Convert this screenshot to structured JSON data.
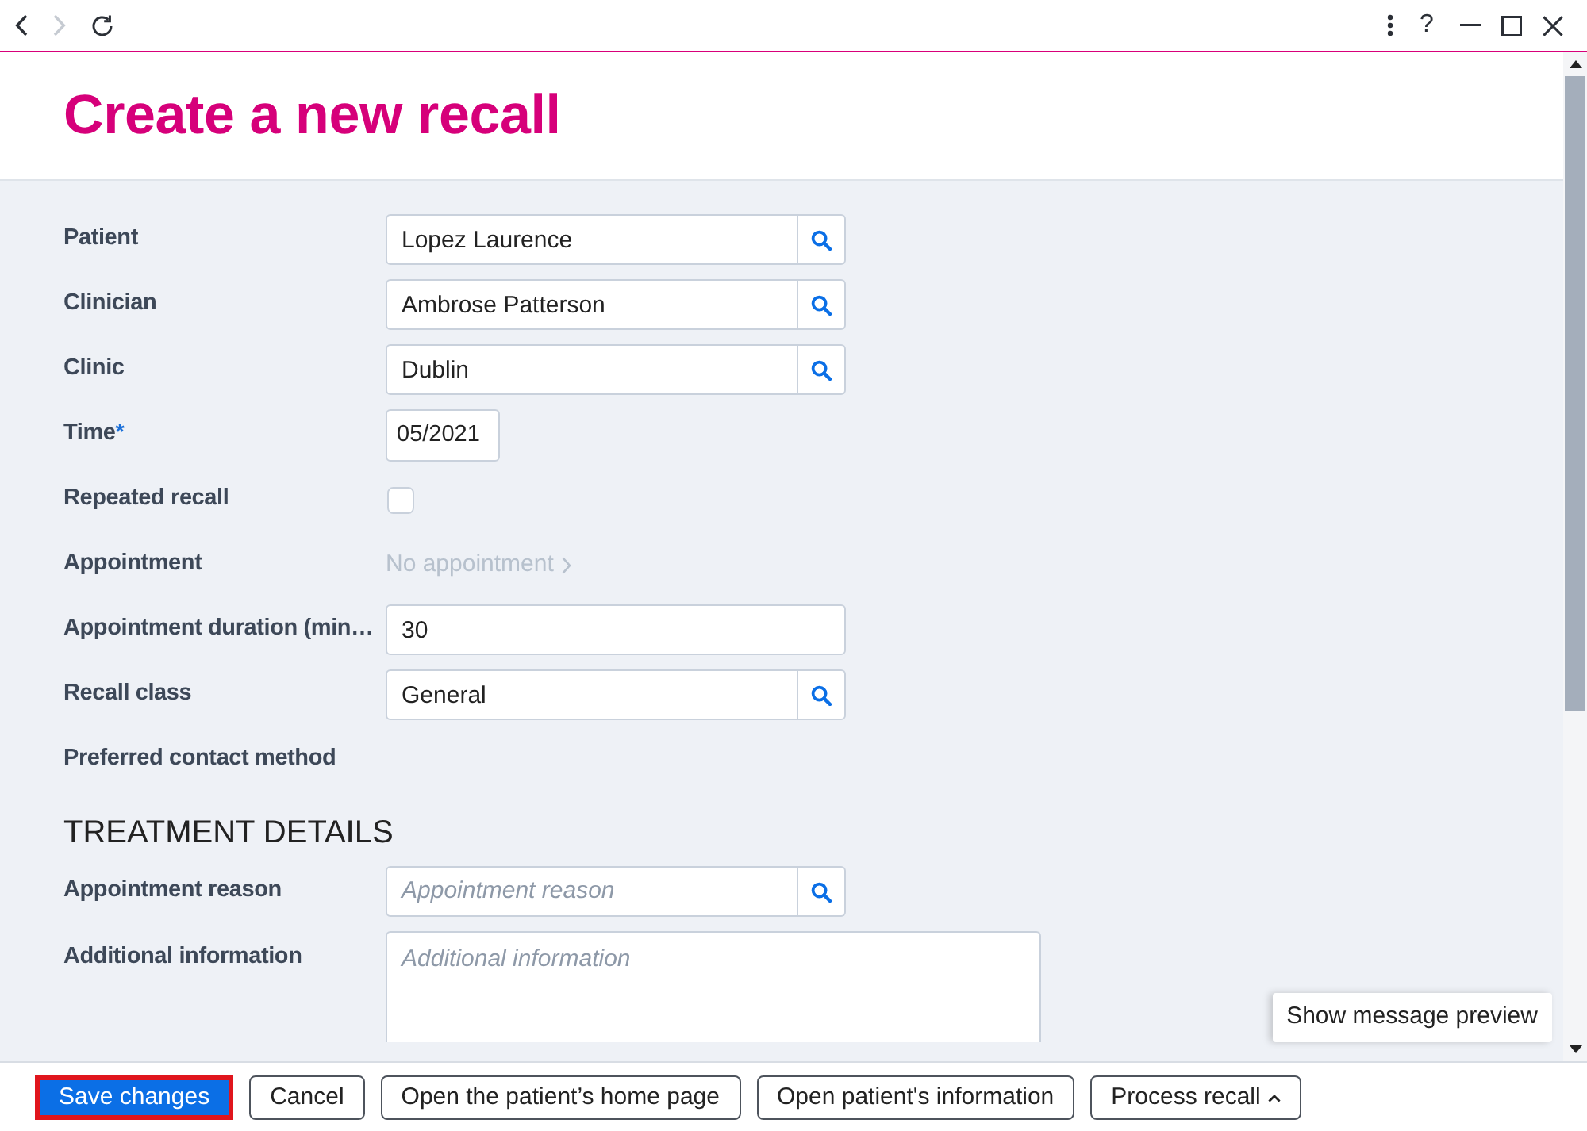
{
  "nav_buttons": [
    {
      "kind": "back",
      "disabled": false
    },
    {
      "kind": "forward",
      "disabled": true
    },
    {
      "kind": "reload",
      "disabled": false
    }
  ],
  "window_controls": [
    {
      "kind": "menu"
    },
    {
      "kind": "help",
      "label": "?"
    },
    {
      "kind": "minimize"
    },
    {
      "kind": "maximize"
    },
    {
      "kind": "close"
    }
  ],
  "page": {
    "title": "Create a new recall"
  },
  "form": {
    "fields": [
      {
        "kind": "lookup",
        "label": "Patient",
        "value": "Lopez Laurence"
      },
      {
        "kind": "lookup",
        "label": "Clinician",
        "value": "Ambrose Patterson"
      },
      {
        "kind": "lookup",
        "label": "Clinic",
        "value": "Dublin"
      },
      {
        "kind": "date",
        "label": "Time",
        "required_mark": "*",
        "value": "05/2021"
      },
      {
        "kind": "checkbox",
        "label": "Repeated recall",
        "checked": false
      },
      {
        "kind": "link",
        "label": "Appointment",
        "link": {
          "text": "No appointment",
          "disabled": true
        }
      },
      {
        "kind": "text",
        "label": "Appointment duration (min…",
        "value": "30"
      },
      {
        "kind": "lookup",
        "label": "Recall class",
        "value": "General"
      },
      {
        "kind": "static",
        "label": "Preferred contact method"
      }
    ]
  },
  "treatment": {
    "heading": "TREATMENT DETAILS",
    "fields": [
      {
        "kind": "lookup",
        "label": "Appointment reason",
        "placeholder": "Appointment reason"
      },
      {
        "kind": "textarea",
        "label": "Additional information",
        "placeholder": "Additional information"
      }
    ]
  },
  "preview_button": {
    "label": "Show message preview"
  },
  "footer": {
    "buttons": [
      {
        "kind": "primary",
        "label": "Save changes",
        "highlighted": true
      },
      {
        "kind": "secondary",
        "label": "Cancel",
        "highlighted": false
      },
      {
        "kind": "secondary",
        "label": "Open the patient’s home page",
        "highlighted": false
      },
      {
        "kind": "secondary",
        "label": "Open patient's information",
        "highlighted": false
      },
      {
        "kind": "dropdown",
        "label": "Process recall",
        "highlighted": false
      }
    ]
  }
}
